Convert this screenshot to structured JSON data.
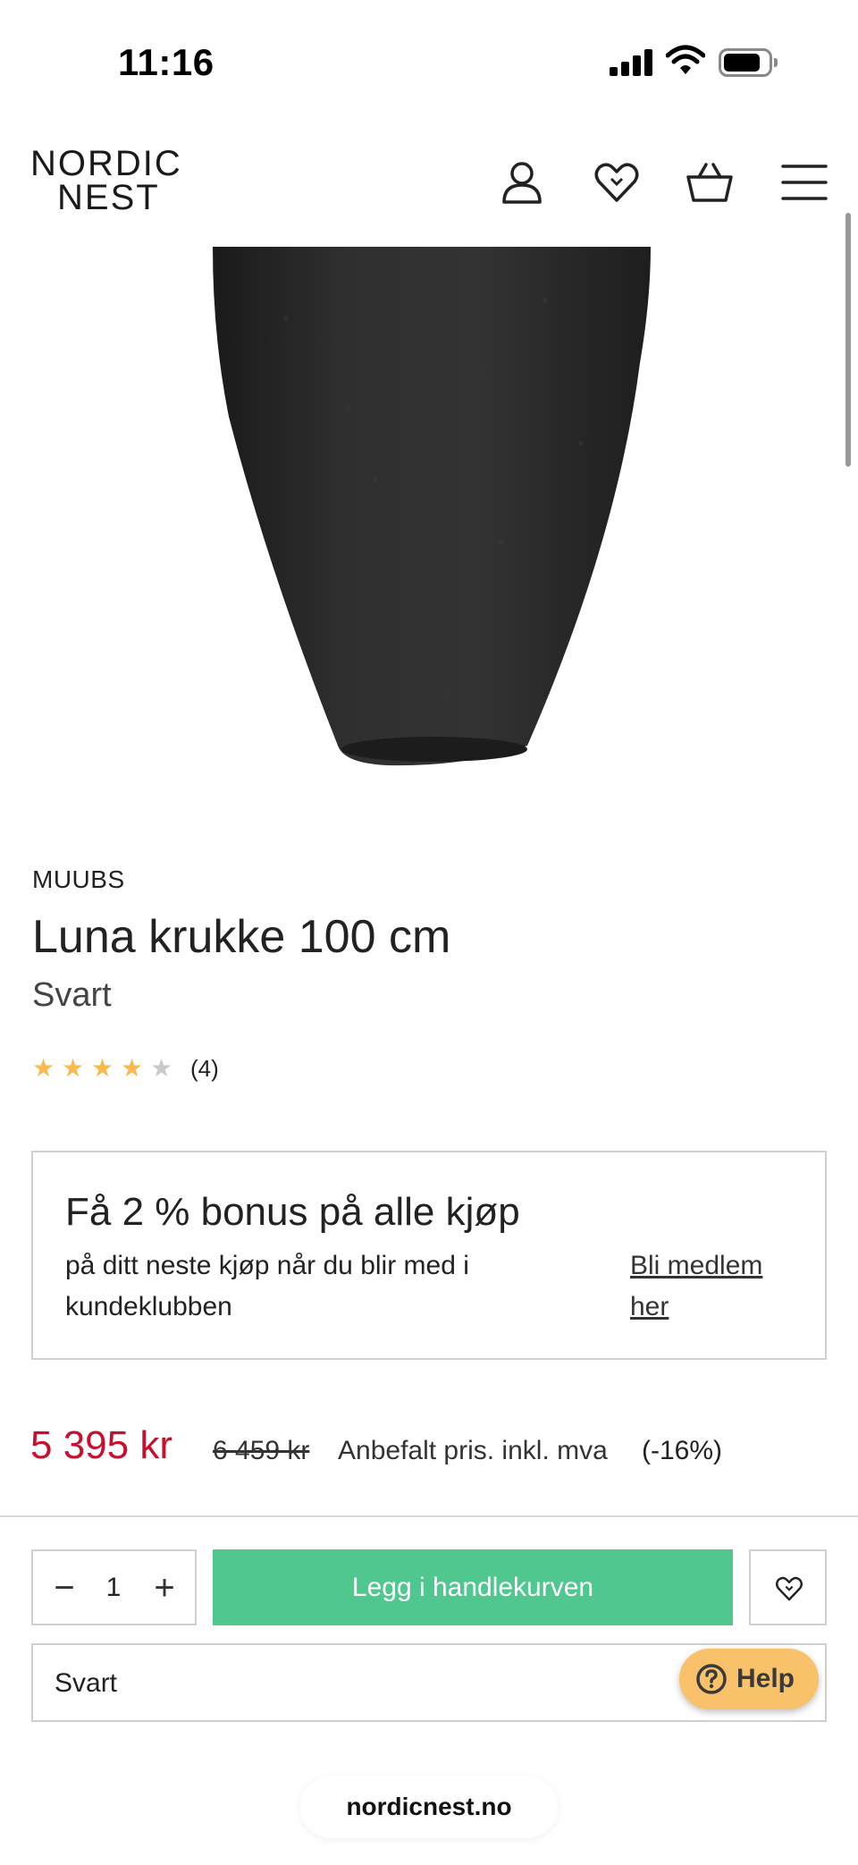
{
  "status_bar": {
    "time": "11:16",
    "icons": [
      "signal-icon",
      "wifi-icon",
      "battery-icon"
    ]
  },
  "header": {
    "logo_line1": "NORDIC",
    "logo_line2": "NEST",
    "icons": [
      "account-icon",
      "wishlist-heart-icon",
      "cart-basket-icon",
      "menu-icon"
    ]
  },
  "product": {
    "brand": "MUUBS",
    "title": "Luna krukke 100 cm",
    "variant": "Svart",
    "rating": {
      "value": 4,
      "max": 5,
      "count": "(4)"
    }
  },
  "bonus": {
    "title": "Få 2 % bonus på alle kjøp",
    "text": "på ditt neste kjøp når du blir med i kundeklubben",
    "link": "Bli medlem her"
  },
  "pricing": {
    "price": "5 395 kr",
    "old_price": "6 459 kr",
    "recommended_label": "Anbefalt pris. inkl. mva",
    "discount": "(-16%)"
  },
  "purchase": {
    "qty_minus": "−",
    "quantity": "1",
    "qty_plus": "+",
    "add_to_cart": "Legg i handlekurven",
    "selected_variant": "Svart"
  },
  "help": {
    "label": "Help"
  },
  "browser": {
    "url": "nordicnest.no"
  },
  "colors": {
    "price_red": "#c8102e",
    "cart_green": "#4fc78f",
    "star_gold": "#f8b94d",
    "help_yellow": "#f8c16a"
  }
}
